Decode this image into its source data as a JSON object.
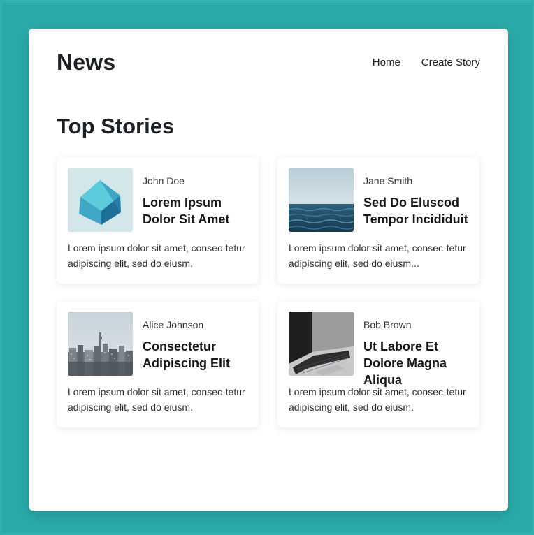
{
  "header": {
    "brand": "News",
    "nav": [
      {
        "label": "Home"
      },
      {
        "label": "Create Story"
      }
    ]
  },
  "section": {
    "title": "Top Stories"
  },
  "stories": [
    {
      "author": "John Doe",
      "title": "Lorem Ipsum Dolor Sit Amet",
      "excerpt": "Lorem ipsum dolor sit amet, consec-tetur adipiscing elit, sed do eiusm.",
      "thumbnail": "cube-image"
    },
    {
      "author": "Jane Smith",
      "title": "Sed Do Eluscod Tempor Incididuit",
      "excerpt": "Lorem ipsum dolor sit amet, consec-tetur adipiscing elit, sed do eiusm...",
      "thumbnail": "ocean-image"
    },
    {
      "author": "Alice Johnson",
      "title": "Consectetur Adipiscing Elit",
      "excerpt": "Lorem ipsum dolor sit amet, consec-tetur adipiscing elit, sed do eiusm.",
      "thumbnail": "city-image"
    },
    {
      "author": "Bob Brown",
      "title": "Ut Labore Et Dolore Magna Aliqua",
      "excerpt": "Lorem ipsum dolor sit amet, consec-tetur adipiscing elit, sed do eiusm.",
      "thumbnail": "laptop-image"
    }
  ],
  "colors": {
    "background": "#2fb1ae",
    "panel": "#ffffff",
    "text": "#1d2125"
  }
}
